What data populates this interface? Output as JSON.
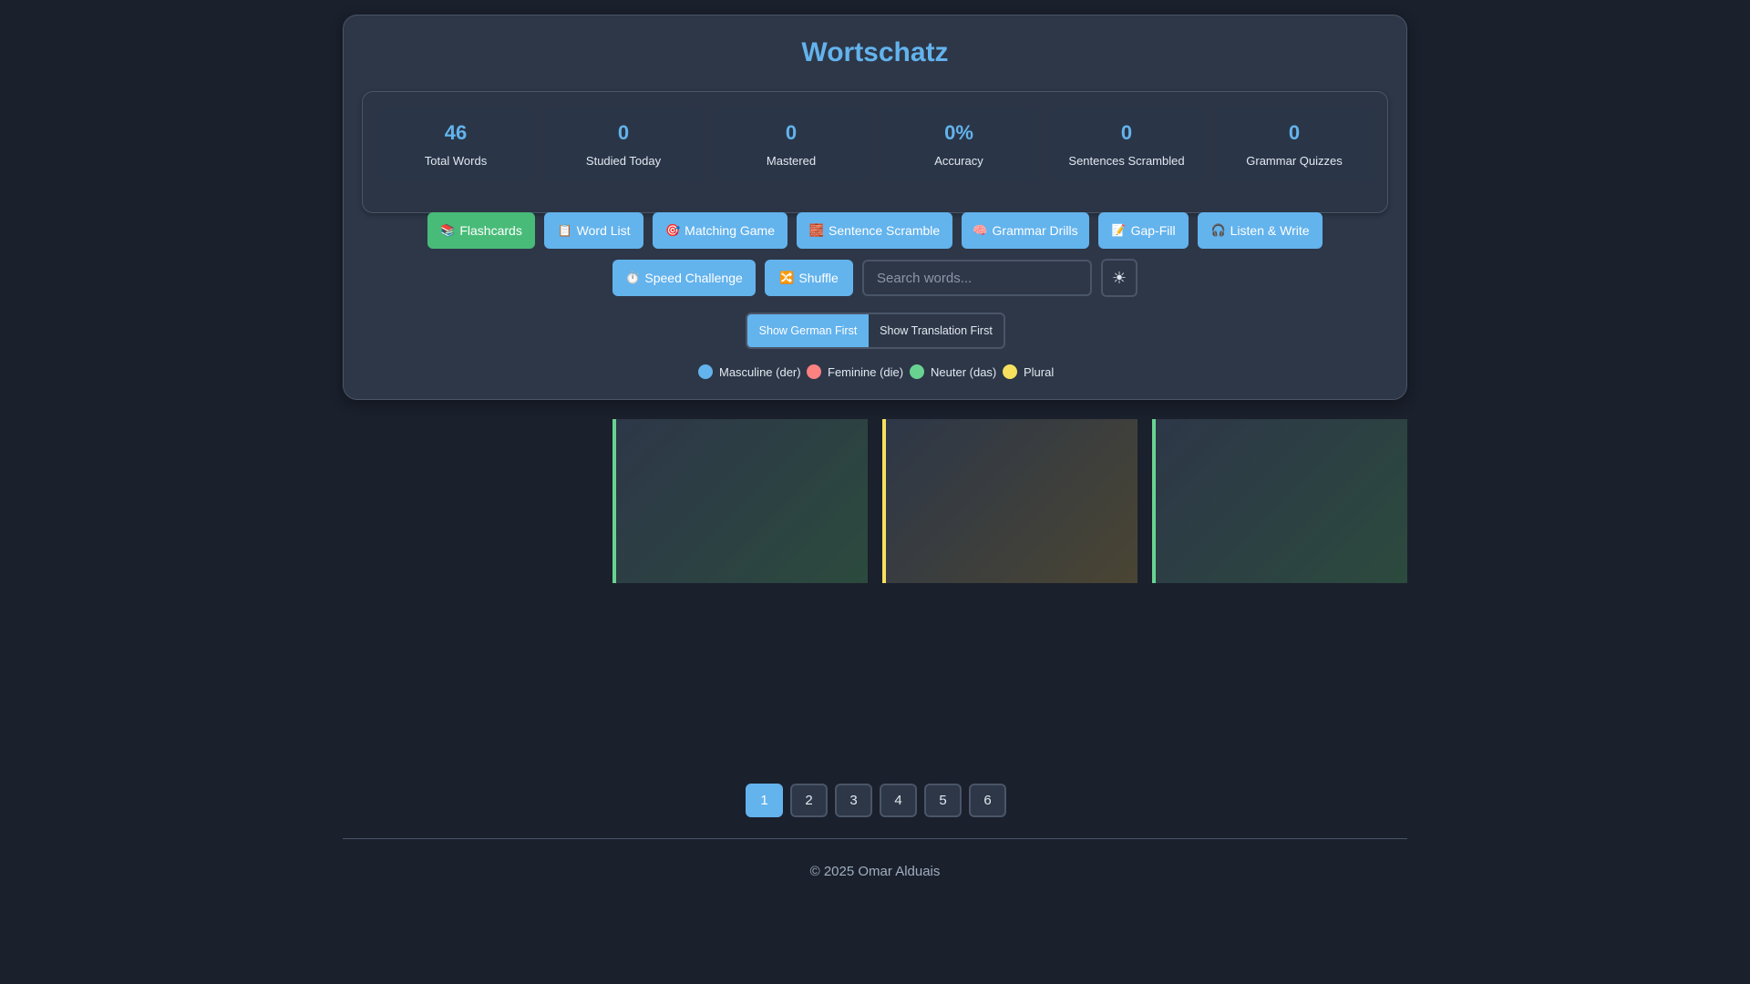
{
  "app": {
    "title": "Wortschatz"
  },
  "stats": [
    {
      "value": "46",
      "label": "Total Words"
    },
    {
      "value": "0",
      "label": "Studied Today"
    },
    {
      "value": "0",
      "label": "Mastered"
    },
    {
      "value": "0%",
      "label": "Accuracy"
    },
    {
      "value": "0",
      "label": "Sentences Scrambled"
    },
    {
      "value": "0",
      "label": "Grammar Quizzes"
    }
  ],
  "modes": [
    {
      "icon": "📚",
      "icon_name": "books-icon",
      "label": "Flashcards",
      "active": true
    },
    {
      "icon": "📋",
      "icon_name": "clipboard-icon",
      "label": "Word List"
    },
    {
      "icon": "🎯",
      "icon_name": "target-icon",
      "label": "Matching Game"
    },
    {
      "icon": "🧱",
      "icon_name": "bricks-icon",
      "label": "Sentence Scramble"
    },
    {
      "icon": "🧠",
      "icon_name": "brain-icon",
      "label": "Grammar Drills"
    },
    {
      "icon": "📝",
      "icon_name": "memo-icon",
      "label": "Gap-Fill"
    },
    {
      "icon": "🎧",
      "icon_name": "headphones-icon",
      "label": "Listen & Write"
    },
    {
      "icon": "⏱️",
      "icon_name": "stopwatch-icon",
      "label": "Speed Challenge"
    },
    {
      "icon": "🔀",
      "icon_name": "shuffle-icon",
      "label": "Shuffle"
    }
  ],
  "search": {
    "placeholder": "Search words...",
    "value": ""
  },
  "theme_toggle": {
    "icon": "☀",
    "icon_name": "sun-icon"
  },
  "display_toggle": {
    "german_first": "Show German First",
    "translation_first": "Show Translation First",
    "selected": "german_first"
  },
  "legend": [
    {
      "label": "Masculine (der)",
      "color": "#63b3ed"
    },
    {
      "label": "Feminine (die)",
      "color": "#fc8181"
    },
    {
      "label": "Neuter (das)",
      "color": "#68d391"
    },
    {
      "label": "Plural",
      "color": "#f6e05e"
    }
  ],
  "cards": [
    {
      "gender": "neuter",
      "accent": "#68d391"
    },
    {
      "gender": "plural",
      "accent": "#f6e05e"
    },
    {
      "gender": "neuter",
      "accent": "#68d391"
    }
  ],
  "pagination": {
    "pages": [
      "1",
      "2",
      "3",
      "4",
      "5",
      "6"
    ],
    "current": "1"
  },
  "footer": {
    "text": "© 2025 Omar Alduais"
  }
}
